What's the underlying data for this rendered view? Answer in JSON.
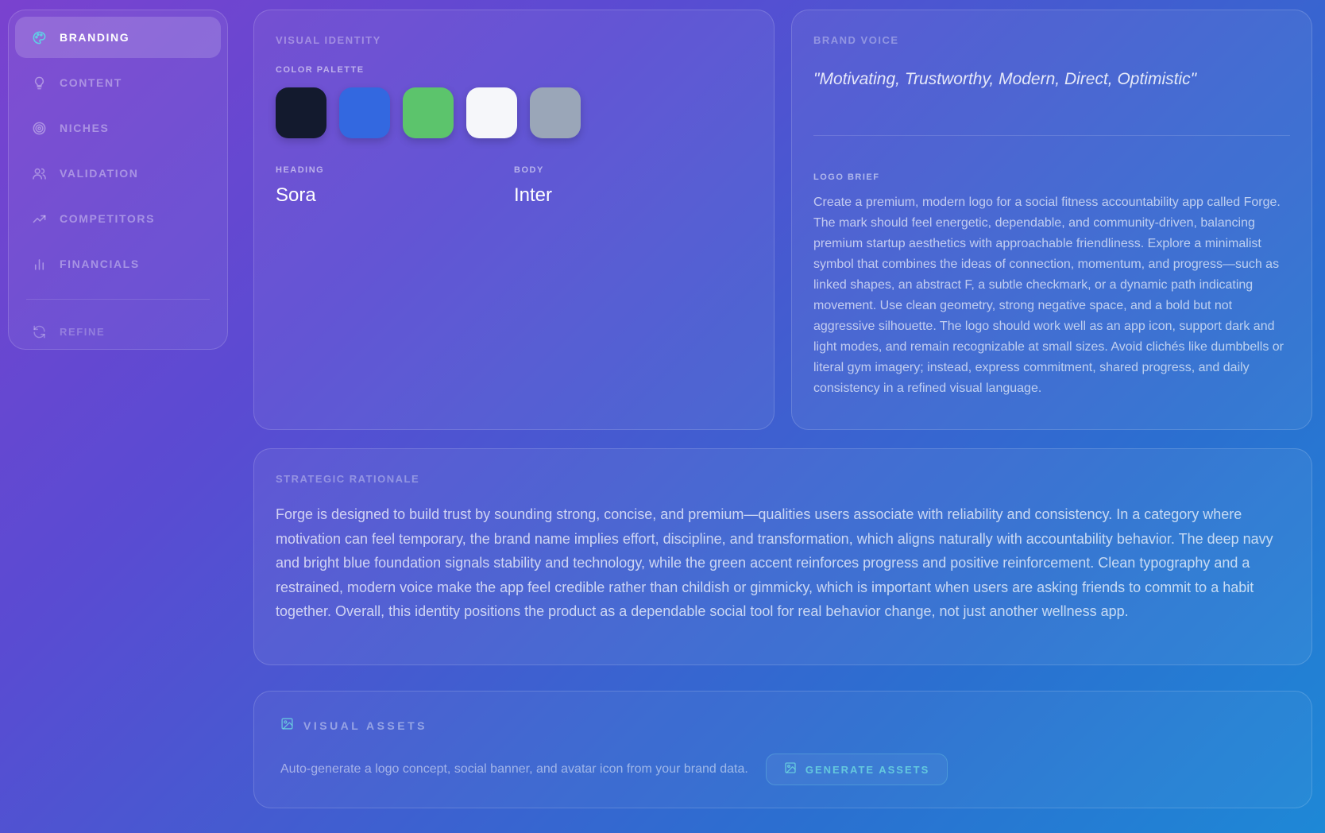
{
  "sidebar": {
    "items": [
      {
        "label": "BRANDING",
        "icon": "palette-icon",
        "active": true
      },
      {
        "label": "CONTENT",
        "icon": "lightbulb-icon"
      },
      {
        "label": "NICHES",
        "icon": "target-icon"
      },
      {
        "label": "VALIDATION",
        "icon": "users-icon"
      },
      {
        "label": "COMPETITORS",
        "icon": "trending-up-icon"
      },
      {
        "label": "FINANCIALS",
        "icon": "bar-chart-icon"
      }
    ],
    "refine": {
      "label": "REFINE",
      "icon": "refresh-icon"
    }
  },
  "visual_identity": {
    "title": "VISUAL IDENTITY",
    "palette_label": "COLOR PALETTE",
    "colors": [
      "#131a2e",
      "#3368e0",
      "#5cc46c",
      "#f6f7fa",
      "#9aa6b8"
    ],
    "heading_label": "HEADING",
    "heading_font": "Sora",
    "body_label": "BODY",
    "body_font": "Inter"
  },
  "brand_voice": {
    "title": "BRAND VOICE",
    "quote": "\"Motivating, Trustworthy, Modern, Direct, Optimistic\"",
    "logo_brief_label": "LOGO BRIEF",
    "logo_brief": "Create a premium, modern logo for a social fitness accountability app called Forge. The mark should feel energetic, dependable, and community-driven, balancing premium startup aesthetics with approachable friendliness. Explore a minimalist symbol that combines the ideas of connection, momentum, and progress—such as linked shapes, an abstract F, a subtle checkmark, or a dynamic path indicating movement. Use clean geometry, strong negative space, and a bold but not aggressive silhouette. The logo should work well as an app icon, support dark and light modes, and remain recognizable at small sizes. Avoid clichés like dumbbells or literal gym imagery; instead, express commitment, shared progress, and daily consistency in a refined visual language."
  },
  "strategic": {
    "title": "STRATEGIC RATIONALE",
    "text": "Forge is designed to build trust by sounding strong, concise, and premium—qualities users associate with reliability and consistency. In a category where motivation can feel temporary, the brand name implies effort, discipline, and transformation, which aligns naturally with accountability behavior. The deep navy and bright blue foundation signals stability and technology, while the green accent reinforces progress and positive reinforcement. Clean typography and a restrained, modern voice make the app feel credible rather than childish or gimmicky, which is important when users are asking friends to commit to a habit together. Overall, this identity positions the product as a dependable social tool for real behavior change, not just another wellness app."
  },
  "assets": {
    "title": "VISUAL ASSETS",
    "description": "Auto-generate a logo concept, social banner, and avatar icon from your brand data.",
    "button_label": "GENERATE ASSETS",
    "icon": "image-icon"
  }
}
